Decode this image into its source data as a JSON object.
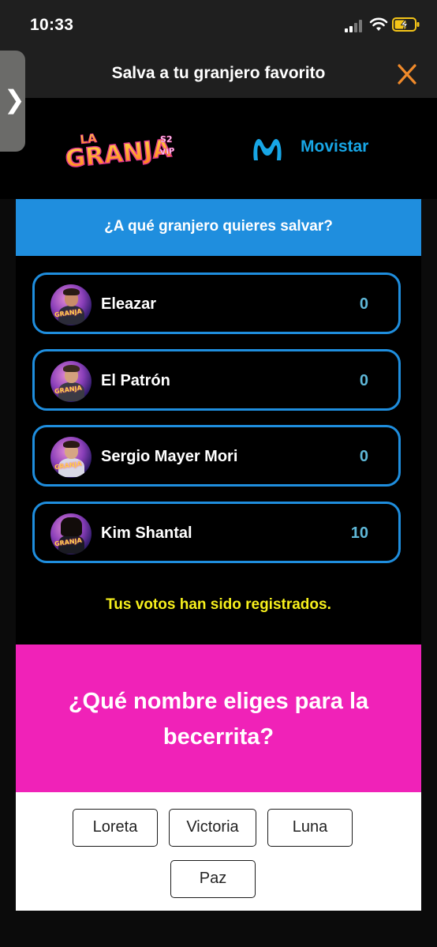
{
  "status": {
    "time": "10:33"
  },
  "header": {
    "title": "Salva a tu granjero favorito"
  },
  "logos": {
    "granja_text": "LA GRANJA VIP",
    "movistar": "Movistar"
  },
  "vote_section": {
    "question": "¿A qué granjero quieres salvar?",
    "candidates": [
      {
        "name": "Eleazar",
        "votes": "0"
      },
      {
        "name": "El Patrón",
        "votes": "0"
      },
      {
        "name": "Sergio Mayer Mori",
        "votes": "0"
      },
      {
        "name": "Kim Shantal",
        "votes": "10"
      }
    ],
    "confirmation": "Tus votos han sido registrados."
  },
  "name_poll": {
    "question": "¿Qué nombre eliges para la becerrita?",
    "options": [
      "Loreta",
      "Victoria",
      "Luna",
      "Paz"
    ]
  },
  "colors": {
    "accent_blue": "#1f8ede",
    "confirm_yellow": "#f7f01c",
    "pink": "#f022b8",
    "close_orange": "#f08a2a"
  }
}
